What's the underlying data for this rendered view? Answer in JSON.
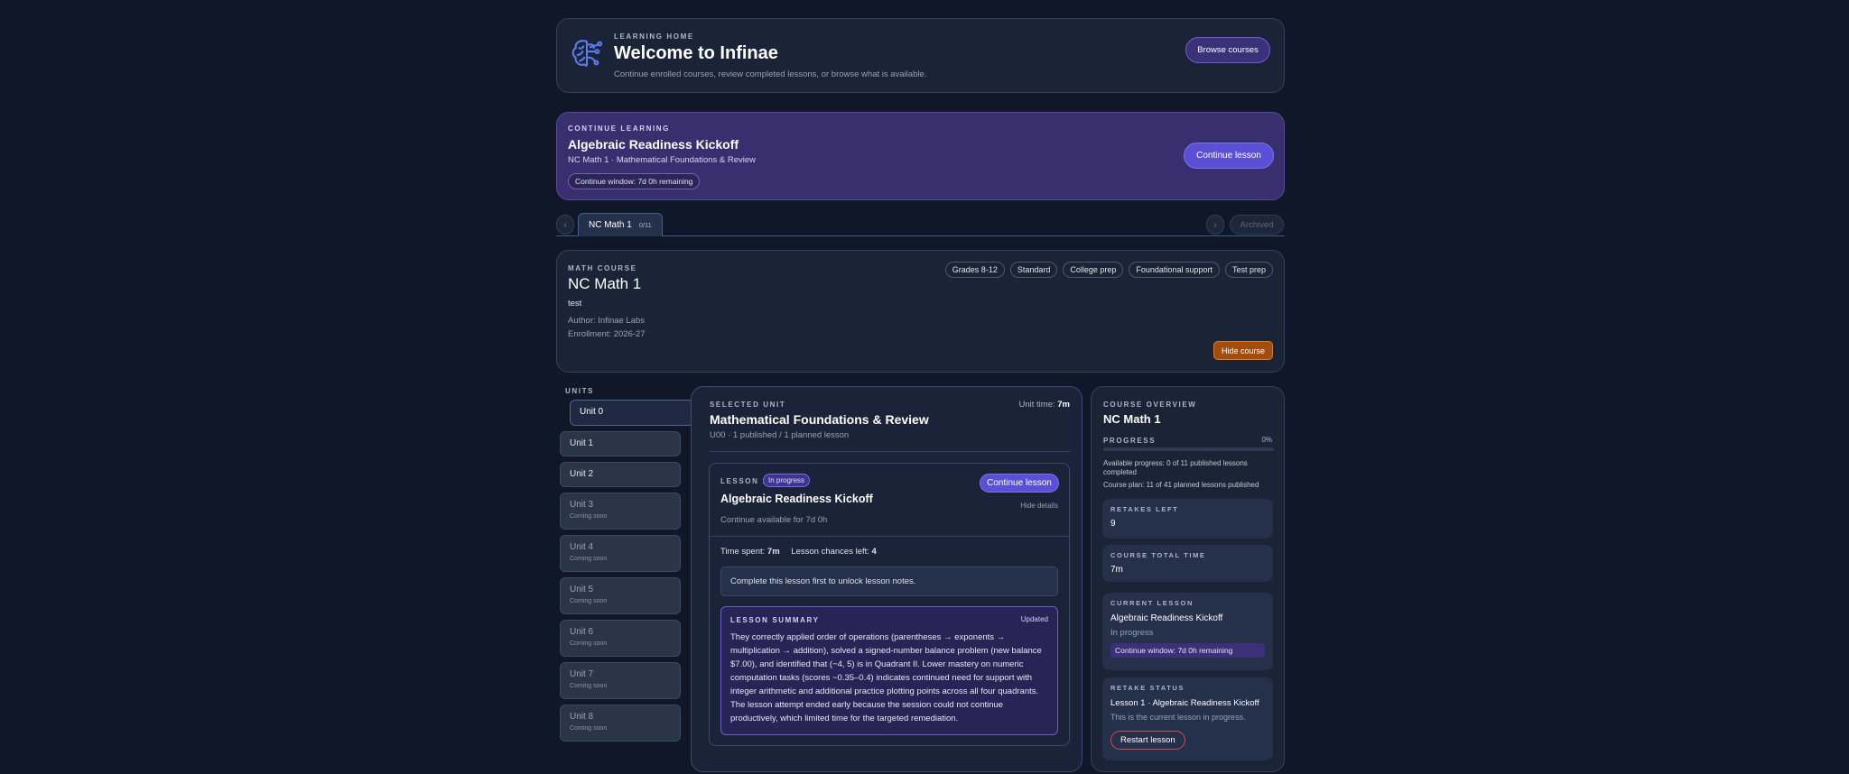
{
  "header": {
    "eyebrow": "LEARNING HOME",
    "title": "Welcome to Infinae",
    "subtitle": "Continue enrolled courses, review completed lessons, or browse what is available.",
    "browse_label": "Browse courses",
    "icon": "brain-icon"
  },
  "continue_learning": {
    "eyebrow": "CONTINUE LEARNING",
    "title": "Algebraic Readiness Kickoff",
    "subtitle": "NC Math 1 · Mathematical Foundations & Review",
    "window_badge": "Continue window: 7d 0h remaining",
    "button_label": "Continue lesson"
  },
  "tabs": {
    "prev_icon": "‹",
    "next_icon": "›",
    "items": [
      {
        "label": "NC Math 1",
        "count": "0/11"
      }
    ],
    "archived_label": "Archived"
  },
  "course": {
    "eyebrow": "MATH COURSE",
    "title": "NC Math 1",
    "description": "test",
    "author": "Author: Infinae Labs",
    "enrollment": "Enrollment: 2026-27",
    "tags": [
      "Grades 8-12",
      "Standard",
      "College prep",
      "Foundational support",
      "Test prep"
    ],
    "hide_label": "Hide course"
  },
  "units": {
    "heading": "UNITS",
    "items": [
      {
        "label": "Unit 0",
        "sub": ""
      },
      {
        "label": "Unit 1",
        "sub": ""
      },
      {
        "label": "Unit 2",
        "sub": ""
      },
      {
        "label": "Unit 3",
        "sub": "Coming soon"
      },
      {
        "label": "Unit 4",
        "sub": "Coming soon"
      },
      {
        "label": "Unit 5",
        "sub": "Coming soon"
      },
      {
        "label": "Unit 6",
        "sub": "Coming soon"
      },
      {
        "label": "Unit 7",
        "sub": "Coming soon"
      },
      {
        "label": "Unit 8",
        "sub": "Coming soon"
      }
    ]
  },
  "selected_unit": {
    "eyebrow": "SELECTED UNIT",
    "unit_time_label": "Unit time:",
    "unit_time_value": "7m",
    "title": "Mathematical Foundations & Review",
    "meta": "U00 · 1 published / 1 planned lesson"
  },
  "lesson": {
    "eyebrow": "LESSON 1",
    "status": "In progress",
    "title": "Algebraic Readiness Kickoff",
    "availability": "Continue available for 7d 0h",
    "continue_label": "Continue lesson",
    "hide_details": "Hide details",
    "time_spent_label": "Time spent:",
    "time_spent_value": "7m",
    "chances_label": "Lesson chances left:",
    "chances_value": "4",
    "notes_locked": "Complete this lesson first to unlock lesson notes.",
    "summary_eyebrow": "LESSON SUMMARY",
    "summary_badge": "Updated",
    "summary_text": "They correctly applied order of operations (parentheses → exponents → multiplication → addition), solved a signed-number balance problem (new balance $7.00), and identified that (−4, 5) is in Quadrant II. Lower mastery on numeric computation tasks (scores ~0.35–0.4) indicates continued need for support with integer arithmetic and additional practice plotting points across all four quadrants. The lesson attempt ended early because the session could not continue productively, which limited time for the targeted remediation."
  },
  "overview": {
    "eyebrow": "COURSE OVERVIEW",
    "title": "NC Math 1",
    "progress_label": "PROGRESS",
    "progress_value": "0%",
    "progress_fraction": 0,
    "available_progress": "Available progress: 0 of 11 published lessons completed",
    "course_plan": "Course plan: 11 of 41 planned lessons published",
    "retakes_label": "RETAKES LEFT",
    "retakes_value": "9",
    "total_time_label": "COURSE TOTAL TIME",
    "total_time_value": "7m",
    "current_lesson_label": "CURRENT LESSON",
    "current_lesson_title": "Algebraic Readiness Kickoff",
    "current_lesson_status": "In progress",
    "current_lesson_window": "Continue window: 7d 0h remaining",
    "retake_status_label": "RETAKE STATUS",
    "retake_status_title": "Lesson 1 · Algebraic Readiness Kickoff",
    "retake_status_text": "This is the current lesson in progress.",
    "restart_label": "Restart lesson"
  },
  "colors": {
    "background": "#0f1729",
    "card": "#1b2436",
    "accent_purple": "#5b4fd6",
    "hide_course": "#c25a0f",
    "restart_border": "#d04a5a"
  }
}
